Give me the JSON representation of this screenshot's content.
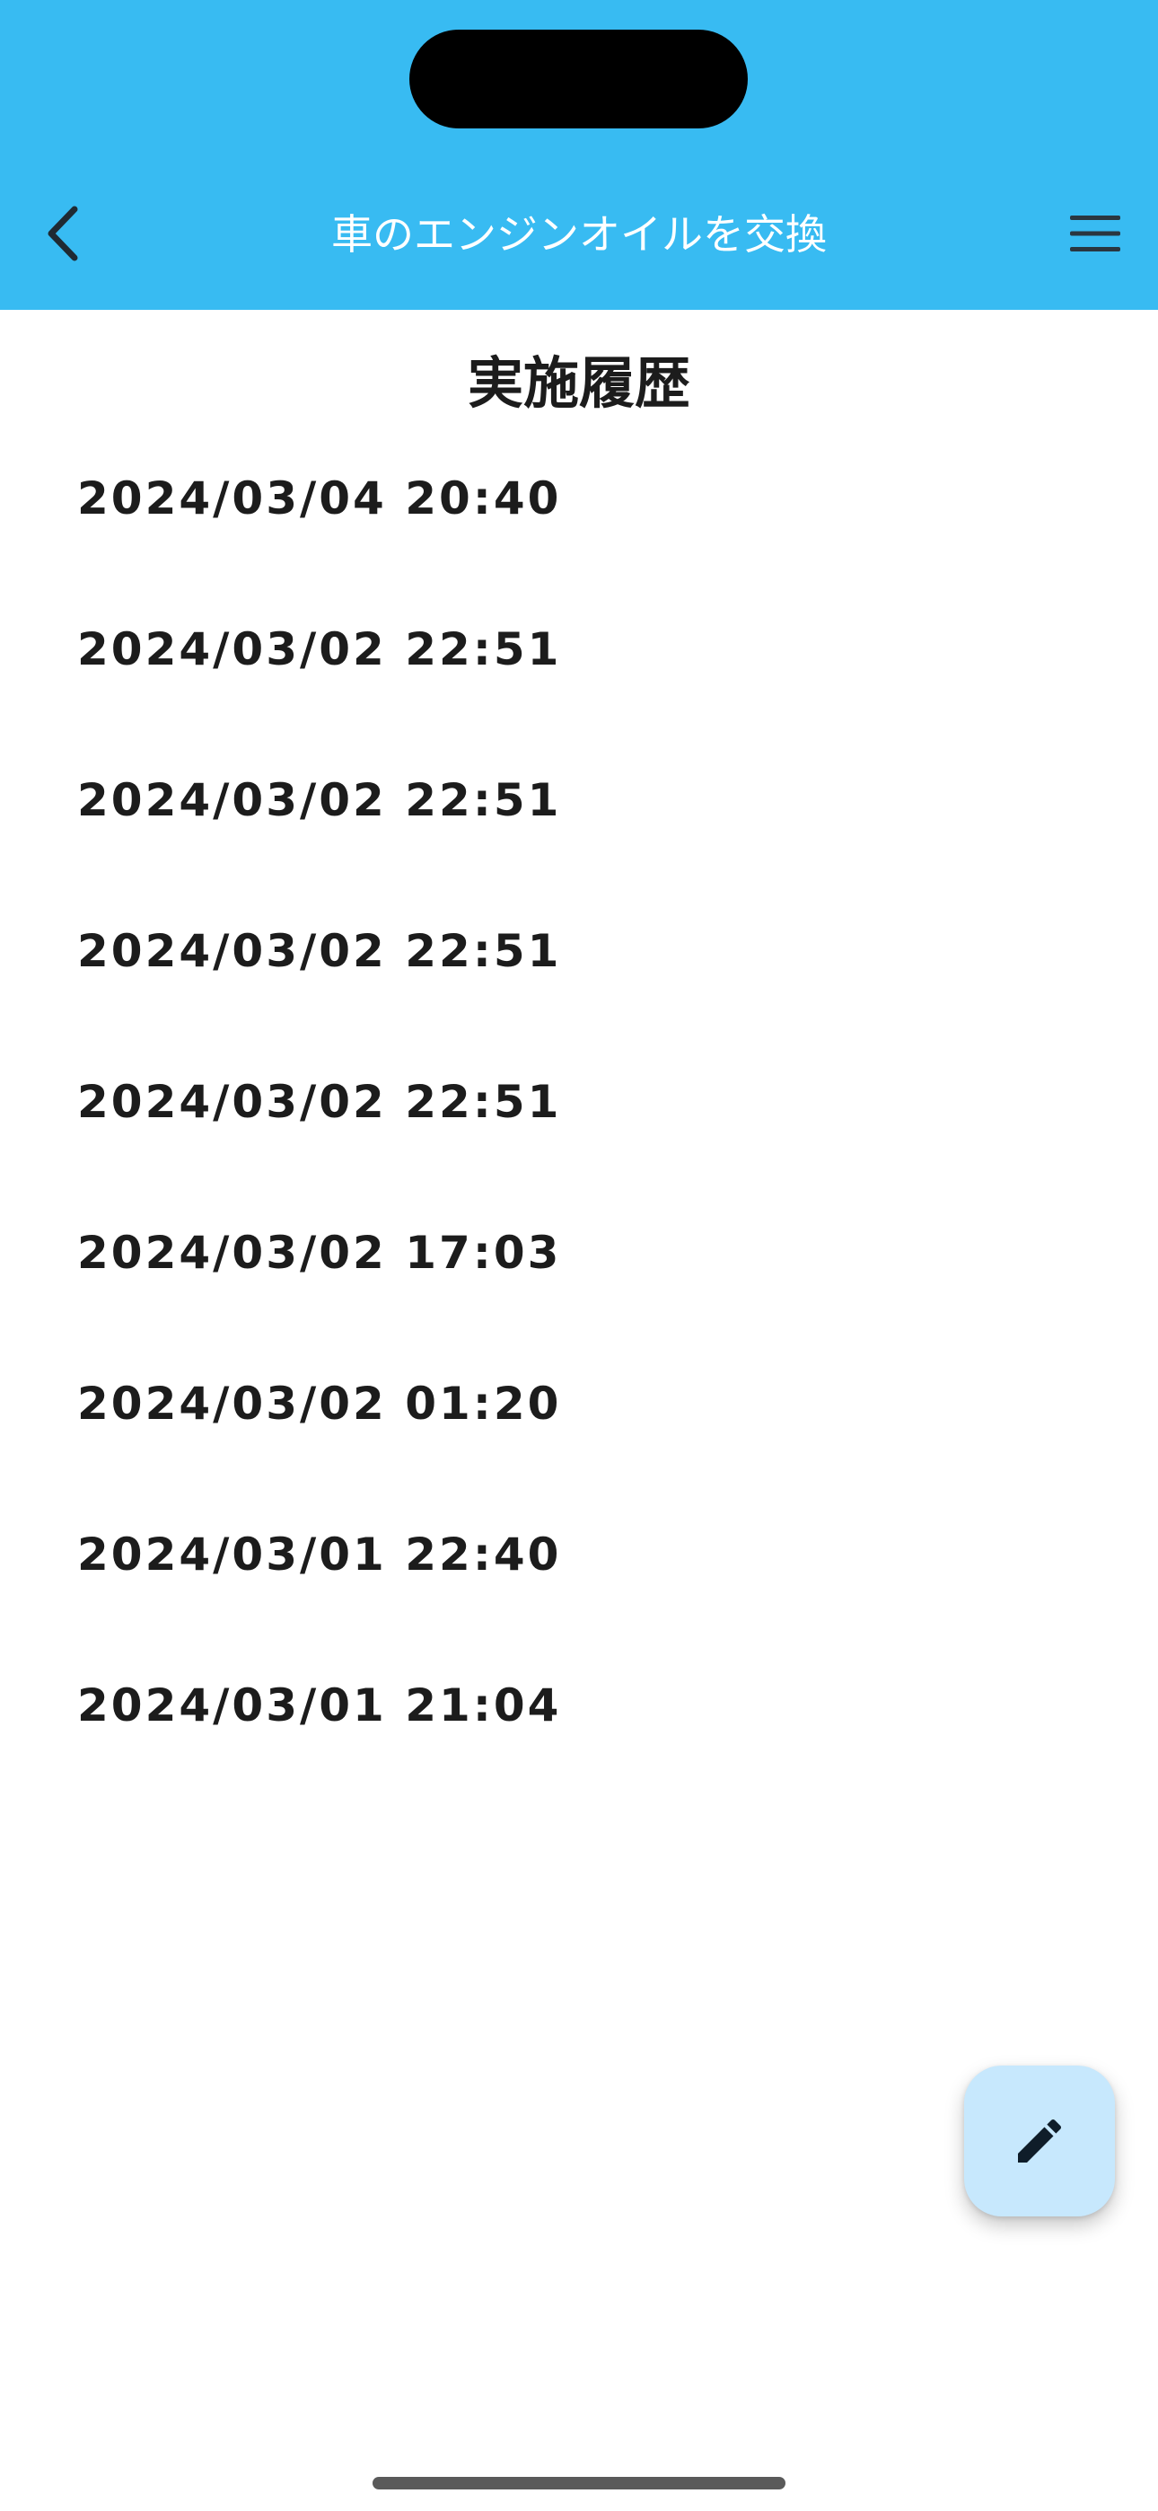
{
  "header": {
    "title": "車のエンジンオイルを交換",
    "back_icon": "chevron-left-icon",
    "menu_icon": "hamburger-menu-icon",
    "background_color": "#38bbf2"
  },
  "main": {
    "section_title": "実施履歴",
    "history": [
      "2024/03/04 20:40",
      "2024/03/02 22:51",
      "2024/03/02 22:51",
      "2024/03/02 22:51",
      "2024/03/02 22:51",
      "2024/03/02 17:03",
      "2024/03/02 01:20",
      "2024/03/01 22:40",
      "2024/03/01 21:04"
    ]
  },
  "fab": {
    "icon": "pencil-icon",
    "background_color": "#c7e8fd"
  }
}
